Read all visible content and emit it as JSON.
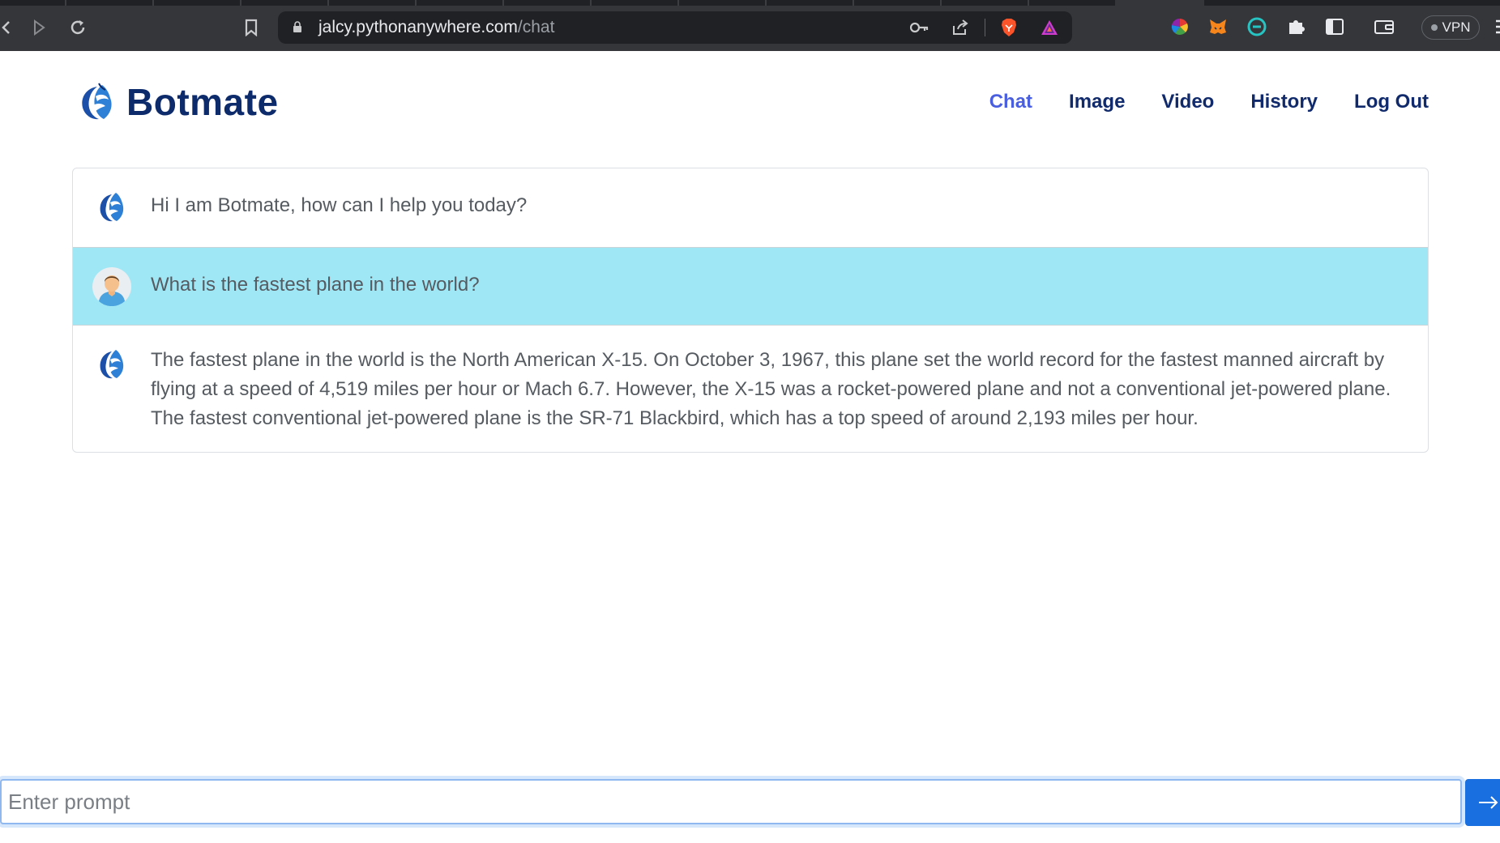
{
  "browser": {
    "url_host": "jalcy.pythonanywhere.com",
    "url_path": "/chat",
    "vpn_label": "VPN"
  },
  "brand": {
    "name": "Botmate",
    "logo_icon": "botmate-logo-icon"
  },
  "nav": {
    "items": [
      {
        "label": "Chat",
        "active": true
      },
      {
        "label": "Image",
        "active": false
      },
      {
        "label": "Video",
        "active": false
      },
      {
        "label": "History",
        "active": false
      },
      {
        "label": "Log Out",
        "active": false
      }
    ]
  },
  "chat": {
    "messages": [
      {
        "sender": "bot",
        "text": "Hi I am Botmate, how can I help you today?"
      },
      {
        "sender": "user",
        "text": "What is the fastest plane in the world?"
      },
      {
        "sender": "bot",
        "text": "The fastest plane in the world is the North American X-15. On October 3, 1967, this plane set the world record for the fastest manned aircraft by flying at a speed of 4,519 miles per hour or Mach 6.7. However, the X-15 was a rocket-powered plane and not a conventional jet-powered plane. The fastest conventional jet-powered plane is the SR-71 Blackbird, which has a top speed of around 2,193 miles per hour."
      }
    ],
    "user_row_color": "#a0e7f5"
  },
  "prompt": {
    "placeholder": "Enter prompt",
    "value": "",
    "send_icon": "arrow-right-icon"
  },
  "colors": {
    "brand": "#0d2b6b",
    "nav_active": "#4a5fe0",
    "send_button": "#1a6fe0"
  }
}
